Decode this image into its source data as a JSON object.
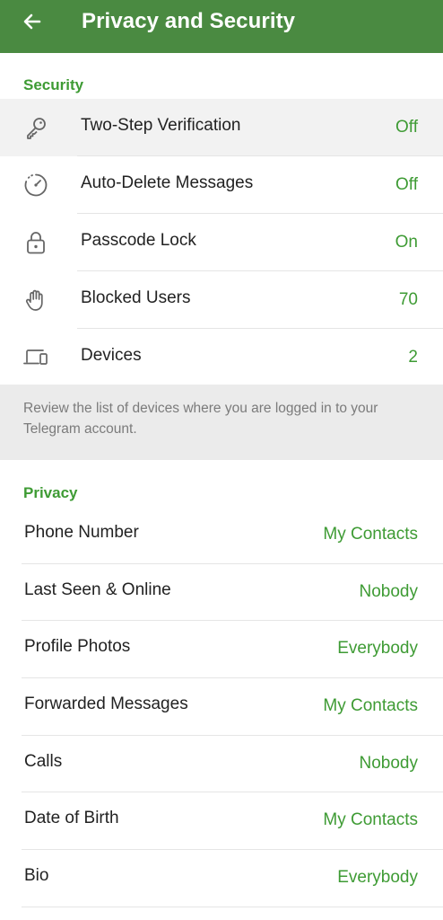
{
  "header": {
    "title": "Privacy and Security",
    "bg_color": "#4a8a41"
  },
  "security": {
    "heading": "Security",
    "items": [
      {
        "label": "Two-Step Verification",
        "value": "Off",
        "icon": "key-icon"
      },
      {
        "label": "Auto-Delete Messages",
        "value": "Off",
        "icon": "auto-delete-timer-icon"
      },
      {
        "label": "Passcode Lock",
        "value": "On",
        "icon": "lock-icon"
      },
      {
        "label": "Blocked Users",
        "value": "70",
        "icon": "hand-icon"
      },
      {
        "label": "Devices",
        "value": "2",
        "icon": "devices-icon"
      }
    ],
    "info": "Review the list of devices where you are logged in to your Telegram account."
  },
  "privacy": {
    "heading": "Privacy",
    "items": [
      {
        "label": "Phone Number",
        "value": "My Contacts"
      },
      {
        "label": "Last Seen & Online",
        "value": "Nobody"
      },
      {
        "label": "Profile Photos",
        "value": "Everybody"
      },
      {
        "label": "Forwarded Messages",
        "value": "My Contacts"
      },
      {
        "label": "Calls",
        "value": "Nobody"
      },
      {
        "label": "Date of Birth",
        "value": "My Contacts"
      },
      {
        "label": "Bio",
        "value": "Everybody"
      }
    ]
  },
  "colors": {
    "accent": "#3e9b34",
    "info_bg": "#ebebeb"
  }
}
